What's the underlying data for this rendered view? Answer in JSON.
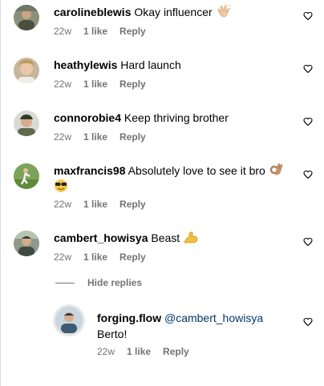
{
  "comments": [
    {
      "username": "carolineblewis",
      "text": "Okay influencer",
      "time": "22w",
      "likes": "1 like",
      "reply": "Reply",
      "emoji": "clapping-hands"
    },
    {
      "username": "heathylewis",
      "text": "Hard launch",
      "time": "22w",
      "likes": "1 like",
      "reply": "Reply"
    },
    {
      "username": "connorobie4",
      "text": "Keep thriving brother",
      "time": "22w",
      "likes": "1 like",
      "reply": "Reply"
    },
    {
      "username": "maxfrancis98",
      "text": "Absolutely love to see it bro",
      "time": "22w",
      "likes": "1 like",
      "reply": "Reply",
      "emoji": "ok-hand-sunglasses-face"
    },
    {
      "username": "cambert_howisya",
      "text": "Beast",
      "time": "22w",
      "likes": "1 like",
      "reply": "Reply",
      "emoji": "flexed-biceps"
    }
  ],
  "replies_toggle": "Hide replies",
  "reply": {
    "username": "forging.flow",
    "mention": "@cambert_howisya",
    "text": "Berto!",
    "time": "22w",
    "likes": "1 like",
    "reply": "Reply"
  },
  "colors": {
    "meta": "#737373",
    "mention": "#00376b",
    "divider": "#dbdbdb"
  },
  "icons": [
    "heart-icon",
    "avatar-photo"
  ]
}
